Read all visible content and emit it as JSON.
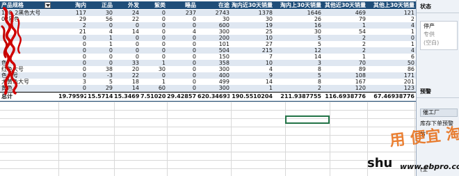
{
  "table": {
    "headers": [
      "产品规格",
      "淘内",
      "正品",
      "外发",
      "絮类",
      "睡品",
      "在途",
      "淘内近30天销量",
      "淘内上30天销量",
      "其他近30天销量",
      "其他上30天销量"
    ],
    "rows": [
      [
        "120_2黑色大号",
        "117",
        "30",
        "24",
        "0",
        "237",
        "2743",
        "1378",
        "1646",
        "469",
        "121"
      ],
      [
        "02黑色",
        "29",
        "56",
        "22",
        "0",
        "0",
        "30",
        "30",
        "26",
        "79",
        "2"
      ],
      [
        "",
        "2",
        "0",
        "0",
        "0",
        "0",
        "600",
        "19",
        "16",
        "1",
        "4"
      ],
      [
        "",
        "21",
        "4",
        "14",
        "0",
        "4",
        "300",
        "25",
        "30",
        "54",
        "1"
      ],
      [
        "",
        "0",
        "1",
        "0",
        "0",
        "0",
        "200",
        "10",
        "5",
        "2",
        "0"
      ],
      [
        "",
        "0",
        "1",
        "0",
        "0",
        "0",
        "101",
        "27",
        "5",
        "2",
        "1"
      ],
      [
        "",
        "0",
        "0",
        "0",
        "0",
        "0",
        "504",
        "215",
        "12",
        "2",
        "4"
      ],
      [
        "",
        "0",
        "0",
        "0",
        "0",
        "0",
        "150",
        "7",
        "14",
        "1",
        "6"
      ],
      [
        "色",
        "0",
        "0",
        "33",
        "1",
        "0",
        "358",
        "10",
        "3",
        "70",
        "50"
      ],
      [
        "红色大号",
        "0",
        "38",
        "20",
        "30",
        "0",
        "300",
        "4",
        "8",
        "89",
        "86"
      ],
      [
        "色大号",
        "0",
        "-3",
        "22",
        "0",
        "0",
        "400",
        "9",
        "5",
        "108",
        "171"
      ],
      [
        "大黄色大号",
        "3",
        "5",
        "18",
        "1",
        "0",
        "499",
        "14",
        "8",
        "167",
        "201"
      ],
      [
        "黄色",
        "0",
        "29",
        "14",
        "60",
        "0",
        "300",
        "1",
        "2",
        "120",
        "123"
      ]
    ],
    "totals": [
      "总计",
      "19.79592",
      "15.57143",
      "15.34694",
      "7.510204",
      "29.42857",
      "620.346939",
      "190.5510204",
      "211.9387755",
      "116.6938776",
      "67.46938776"
    ]
  },
  "pane": {
    "title": "状态",
    "list_items": [
      "停产",
      "专供",
      "(空白)"
    ],
    "section2_label": "预警",
    "button_label": "催工厂",
    "text1": "库存下单预警",
    "text2": "节",
    "text3": "(全"
  },
  "watermark": {
    "line1": "用 便宜 淘宝",
    "line2": "shu",
    "line3": "www.ebpro.com"
  },
  "colors": {
    "header_bg": "#1f4e79",
    "band_bg": "#dfe7f1",
    "scribble": "#d00000",
    "watermark": "#e86a10"
  }
}
